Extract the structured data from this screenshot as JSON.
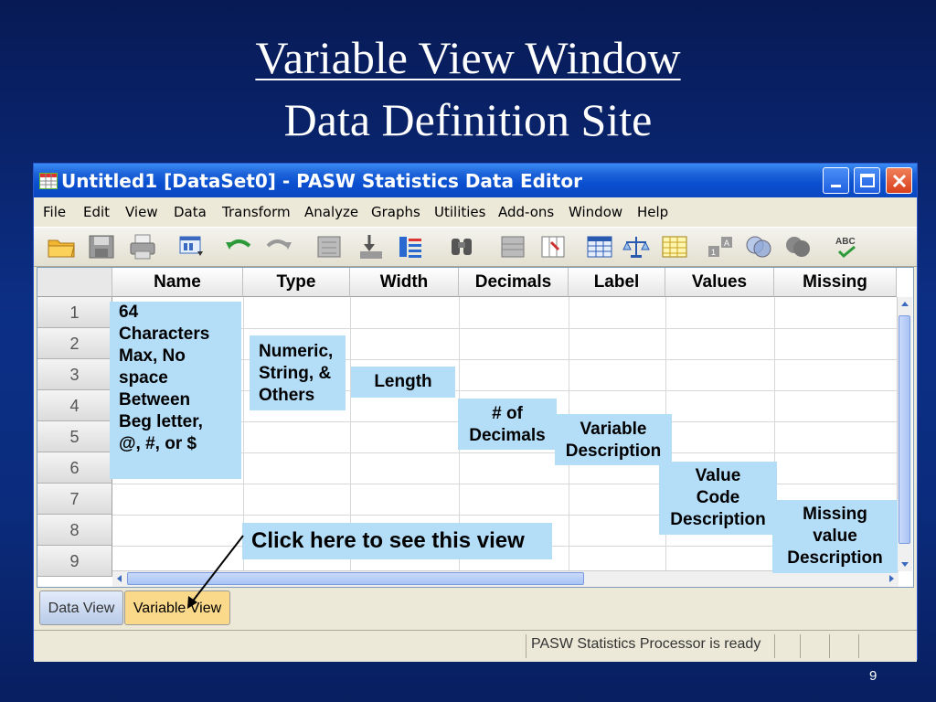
{
  "slide": {
    "title_line1": "Variable View Window",
    "title_line2": "Data Definition Site",
    "page_number": "9"
  },
  "window": {
    "title": "Untitled1 [DataSet0] - PASW Statistics Data Editor",
    "controls": [
      "minimize-icon",
      "maximize-icon",
      "close-icon"
    ]
  },
  "menu": [
    "File",
    "Edit",
    "View",
    "Data",
    "Transform",
    "Analyze",
    "Graphs",
    "Utilities",
    "Add-ons",
    "Window",
    "Help"
  ],
  "toolbar_icons": [
    "open-folder-icon",
    "save-icon",
    "print-icon",
    "dialog-recall-icon",
    "undo-icon",
    "redo-icon",
    "goto-case-icon",
    "goto-variable-icon",
    "variables-icon",
    "find-icon",
    "insert-cases-icon",
    "insert-variable-icon",
    "split-file-icon",
    "weight-cases-icon",
    "select-cases-icon",
    "value-labels-icon",
    "use-sets-icon",
    "show-all-variables-icon",
    "spell-check-icon"
  ],
  "grid": {
    "columns": [
      "Name",
      "Type",
      "Width",
      "Decimals",
      "Label",
      "Values",
      "Missing"
    ],
    "rows": [
      "1",
      "2",
      "3",
      "4",
      "5",
      "6",
      "7",
      "8",
      "9"
    ]
  },
  "callouts": {
    "name_lines": [
      "64",
      "Characters",
      "Max, No",
      "space",
      "Between",
      "Beg letter,",
      "@, #, or $"
    ],
    "type_lines": [
      "Numeric,",
      "String, &",
      "Others"
    ],
    "width": "Length",
    "decimals_lines": [
      "# of",
      "Decimals"
    ],
    "label_lines": [
      "Variable",
      "Description"
    ],
    "values_lines": [
      "Value",
      "Code",
      "Description"
    ],
    "missing_lines": [
      "Missing",
      "value",
      "Description"
    ],
    "click": "Click here to see this view"
  },
  "tabs": {
    "data_view": "Data View",
    "variable_view": "Variable View",
    "active": "Variable View"
  },
  "status": "PASW Statistics Processor is ready",
  "colors": {
    "callout_bg": "#b4ddf8",
    "active_tab": "#fbd98a",
    "slide_bg": "#0c2f86"
  }
}
